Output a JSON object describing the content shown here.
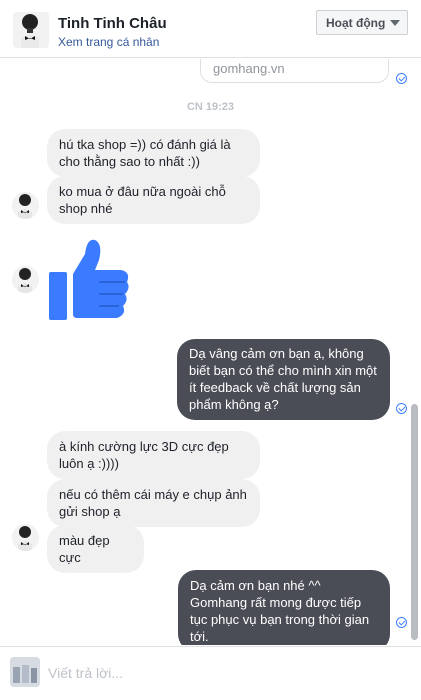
{
  "header": {
    "contact_name": "Tinh Tinh Châu",
    "profile_link": "Xem trang cá nhân",
    "status_button": "Hoạt động"
  },
  "conversation": {
    "link_preview_domain": "gomhang.vn",
    "timestamp": "CN 19:23",
    "messages": [
      {
        "direction": "incoming",
        "text": "hú tka shop =)) có đánh giá là cho thằng sao to nhất :))"
      },
      {
        "direction": "incoming",
        "text": "ko mua ở đâu nữa ngoài chỗ shop nhé"
      },
      {
        "direction": "incoming",
        "type": "like-sticker"
      },
      {
        "direction": "outgoing",
        "text": "Dạ vâng cảm ơn bạn ạ, không biết bạn có thể cho mình xin một ít feedback về chất lượng sản phẩm không ạ?"
      },
      {
        "direction": "incoming",
        "text": "à kính cường lực 3D cực đẹp luôn ạ :))))"
      },
      {
        "direction": "incoming",
        "text": "nếu có thêm cái máy e chụp ảnh gửi shop ạ"
      },
      {
        "direction": "incoming",
        "text": "màu đẹp cực"
      },
      {
        "direction": "outgoing",
        "text": "Dạ cảm ơn bạn nhé ^^\nGomhang rất mong được tiếp tục phục vụ bạn trong thời gian tới."
      }
    ]
  },
  "composer": {
    "placeholder": "Viết trả lời..."
  },
  "colors": {
    "outgoing_bubble": "#4a4d55",
    "incoming_bubble": "#f1f0f0",
    "accent_link": "#365899",
    "like_blue": "#4080ff"
  }
}
